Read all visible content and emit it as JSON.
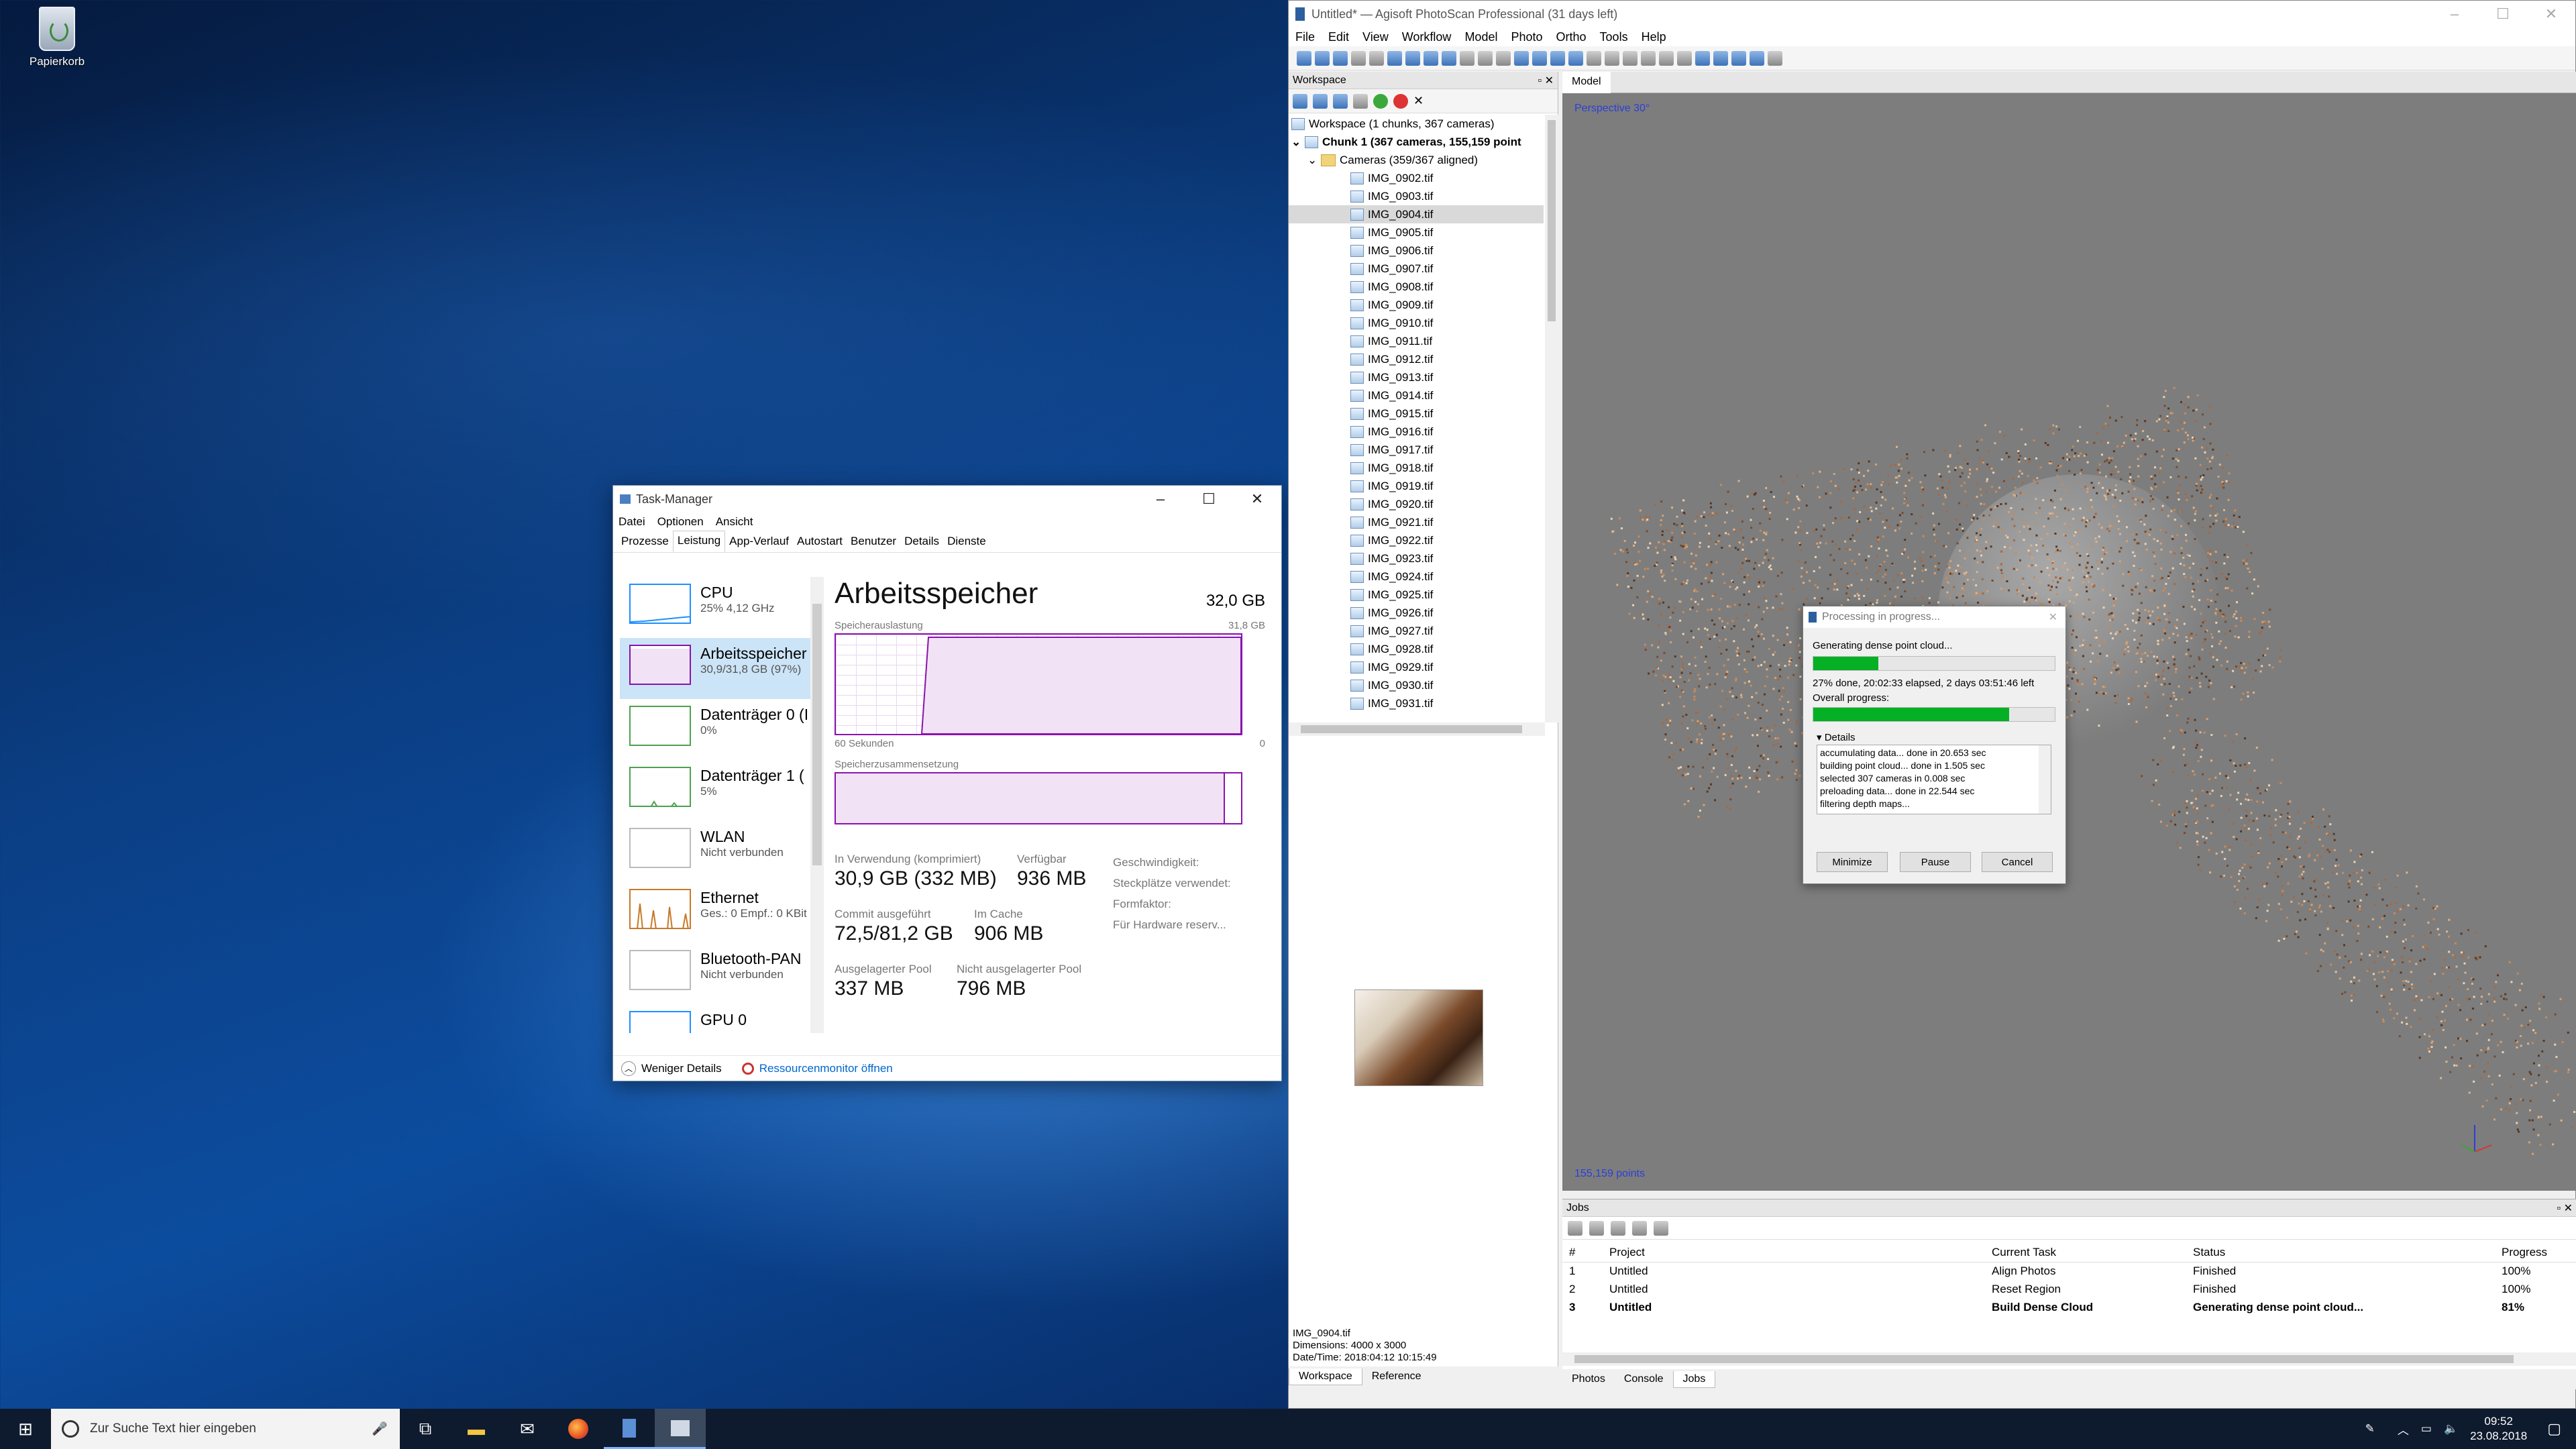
{
  "desktop": {
    "recycle_bin_label": "Papierkorb"
  },
  "task_manager": {
    "title": "Task-Manager",
    "menu": [
      "Datei",
      "Optionen",
      "Ansicht"
    ],
    "tabs": [
      "Prozesse",
      "Leistung",
      "App-Verlauf",
      "Autostart",
      "Benutzer",
      "Details",
      "Dienste"
    ],
    "sidebar": [
      {
        "name": "CPU",
        "sub": "25% 4,12 GHz"
      },
      {
        "name": "Arbeitsspeicher",
        "sub": "30,9/31,8 GB (97%)"
      },
      {
        "name": "Datenträger 0 (I",
        "sub": "0%"
      },
      {
        "name": "Datenträger 1 (",
        "sub": "5%"
      },
      {
        "name": "WLAN",
        "sub": "Nicht verbunden"
      },
      {
        "name": "Ethernet",
        "sub": "Ges.: 0 Empf.: 0 KBit"
      },
      {
        "name": "Bluetooth-PAN",
        "sub": "Nicht verbunden"
      },
      {
        "name": "GPU 0",
        "sub": ""
      }
    ],
    "heading": "Arbeitsspeicher",
    "total": "32,0 GB",
    "usage_label": "Speicherauslastung",
    "usage_max": "31,8 GB",
    "graph_left": "60 Sekunden",
    "graph_right": "0",
    "composition_label": "Speicherzusammensetzung",
    "stats": {
      "in_use_k": "In Verwendung (komprimiert)",
      "in_use_v": "30,9 GB (332 MB)",
      "avail_k": "Verfügbar",
      "avail_v": "936 MB",
      "commit_k": "Commit ausgeführt",
      "commit_v": "72,5/81,2 GB",
      "cache_k": "Im Cache",
      "cache_v": "906 MB",
      "paged_k": "Ausgelagerter Pool",
      "paged_v": "337 MB",
      "nonpaged_k": "Nicht ausgelagerter Pool",
      "nonpaged_v": "796 MB",
      "speed_k": "Geschwindigkeit:",
      "slots_k": "Steckplätze verwendet:",
      "form_k": "Formfaktor:",
      "hw_k": "Für Hardware reserv..."
    },
    "footer_less": "Weniger Details",
    "footer_monitor": "Ressourcenmonitor öffnen"
  },
  "photoscan": {
    "title": "Untitled* — Agisoft PhotoScan Professional (31 days left)",
    "menu": [
      "File",
      "Edit",
      "View",
      "Workflow",
      "Model",
      "Photo",
      "Ortho",
      "Tools",
      "Help"
    ],
    "workspace_title": "Workspace",
    "workspace_root": "Workspace (1 chunks, 367 cameras)",
    "chunk": "Chunk 1 (367 cameras, 155,159 point",
    "cameras": "Cameras (359/367 aligned)",
    "images": [
      "IMG_0902.tif",
      "IMG_0903.tif",
      "IMG_0904.tif",
      "IMG_0905.tif",
      "IMG_0906.tif",
      "IMG_0907.tif",
      "IMG_0908.tif",
      "IMG_0909.tif",
      "IMG_0910.tif",
      "IMG_0911.tif",
      "IMG_0912.tif",
      "IMG_0913.tif",
      "IMG_0914.tif",
      "IMG_0915.tif",
      "IMG_0916.tif",
      "IMG_0917.tif",
      "IMG_0918.tif",
      "IMG_0919.tif",
      "IMG_0920.tif",
      "IMG_0921.tif",
      "IMG_0922.tif",
      "IMG_0923.tif",
      "IMG_0924.tif",
      "IMG_0925.tif",
      "IMG_0926.tif",
      "IMG_0927.tif",
      "IMG_0928.tif",
      "IMG_0929.tif",
      "IMG_0930.tif",
      "IMG_0931.tif"
    ],
    "selected_image": "IMG_0904.tif",
    "info_dimensions": "Dimensions: 4000 x 3000",
    "info_datetime": "Date/Time: 2018:04:12 10:15:49",
    "ws_tabs": [
      "Workspace",
      "Reference"
    ],
    "model_tab": "Model",
    "perspective": "Perspective 30°",
    "points": "155,159 points",
    "jobs_title": "Jobs",
    "jobs_headers": [
      "#",
      "Project",
      "Current Task",
      "Status",
      "Progress"
    ],
    "jobs_rows": [
      [
        "1",
        "Untitled",
        "Align Photos",
        "Finished",
        "100%"
      ],
      [
        "2",
        "Untitled",
        "Reset Region",
        "Finished",
        "100%"
      ],
      [
        "3",
        "Untitled",
        "Build Dense Cloud",
        "Generating dense point cloud...",
        "81%"
      ]
    ],
    "bottom_tabs": [
      "Photos",
      "Console",
      "Jobs"
    ]
  },
  "dialog": {
    "title": "Processing in progress...",
    "task": "Generating dense point cloud...",
    "task_progress": 0.27,
    "status_line": "27% done, 20:02:33 elapsed, 2 days 03:51:46 left",
    "overall_label": "Overall progress:",
    "overall_progress": 0.81,
    "details_label": "Details",
    "log": [
      "accumulating data... done in 20.653 sec",
      "building point cloud... done in 1.505 sec",
      "selected 307 cameras in 0.008 sec",
      "preloading data... done in 22.544 sec",
      "filtering depth maps..."
    ],
    "btn_minimize": "Minimize",
    "btn_pause": "Pause",
    "btn_cancel": "Cancel"
  },
  "taskbar": {
    "search_placeholder": "Zur Suche Text hier eingeben",
    "time": "09:52",
    "date": "23.08.2018"
  },
  "colors": {
    "accent": "#0078d7",
    "memory": "#8b12ae",
    "progress": "#06b025"
  }
}
